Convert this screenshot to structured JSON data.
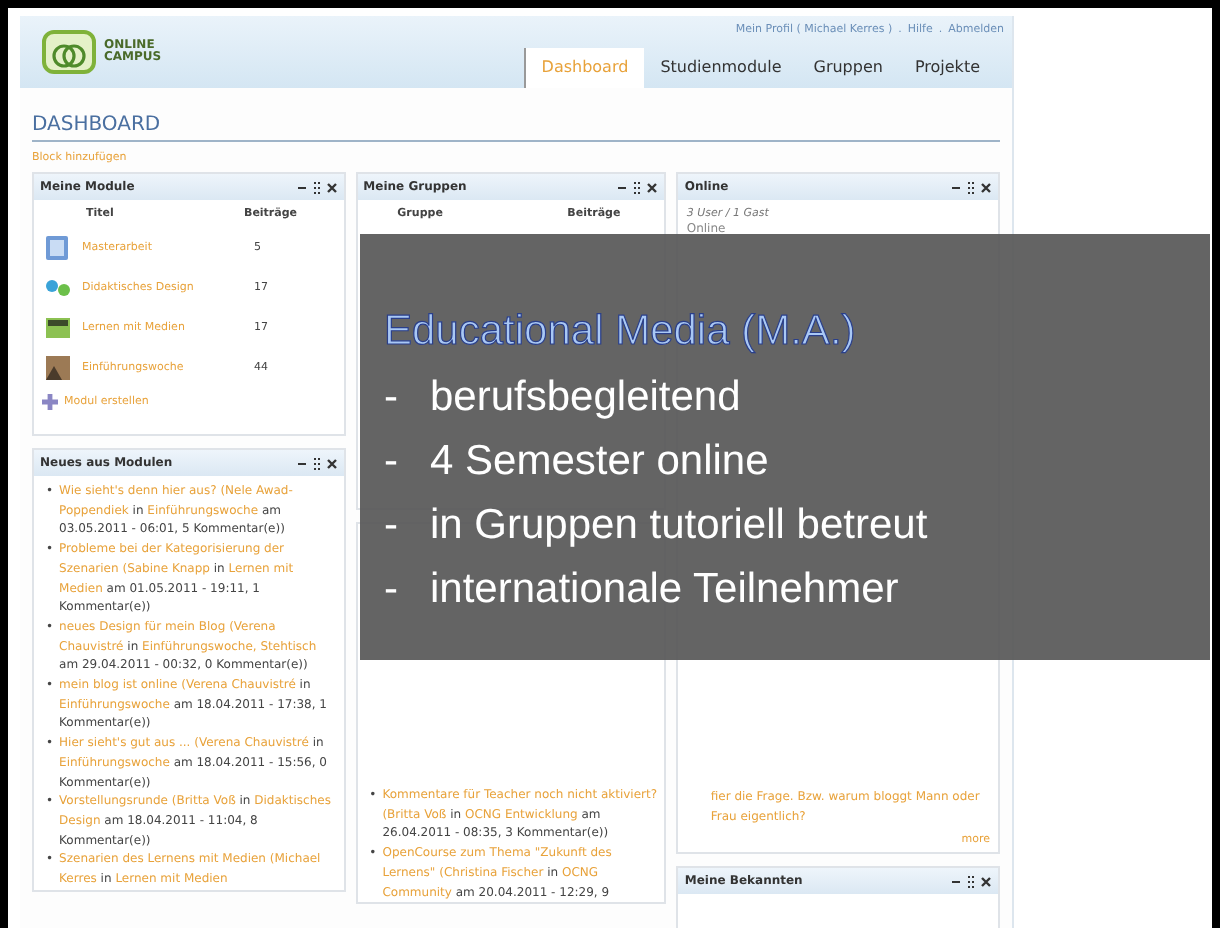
{
  "header": {
    "logo": [
      "ONLINE",
      "CAMPUS"
    ],
    "links": [
      "Mein Profil ( Michael Kerres )",
      "Hilfe",
      "Abmelden"
    ],
    "separator": "."
  },
  "tabs": [
    {
      "label": "Dashboard",
      "selected": true
    },
    {
      "label": "Studienmodule",
      "selected": false
    },
    {
      "label": "Gruppen",
      "selected": false
    },
    {
      "label": "Projekte",
      "selected": false
    }
  ],
  "page_title": "DASHBOARD",
  "add_block": "Block hinzufügen",
  "modules": {
    "title": "Meine Module",
    "columns": [
      "Titel",
      "Beiträge"
    ],
    "rows": [
      {
        "name": "Masterarbeit",
        "count": "5"
      },
      {
        "name": "Didaktisches Design",
        "count": "17"
      },
      {
        "name": "Lernen mit Medien",
        "count": "17"
      },
      {
        "name": "Einführungswoche",
        "count": "44"
      }
    ],
    "create": "Modul erstellen"
  },
  "module_news": {
    "title": "Neues aus Modulen",
    "items": [
      {
        "title": "Wie sieht's denn hier aus?",
        "author": "(Nele Awad-Poppendiek",
        "in": "in",
        "place": "Einführungswoche",
        "tail": "am 03.05.2011 - 06:01, 5 Kommentar(e))"
      },
      {
        "title": "Probleme bei der Kategorisierung der Szenarien",
        "author": "(Sabine Knapp",
        "in": "in",
        "place": "Lernen mit Medien",
        "tail": "am 01.05.2011 - 19:11, 1 Kommentar(e))"
      },
      {
        "title": "neues Design für mein Blog",
        "author": "(Verena Chauvistré",
        "in": "in",
        "place": "Einführungswoche, Stehtisch",
        "tail": "am 29.04.2011 - 00:32, 0 Kommentar(e))"
      },
      {
        "title": "mein blog ist online",
        "author": "(Verena Chauvistré",
        "in": "in",
        "place": "Einführungswoche",
        "tail": "am 18.04.2011 - 17:38, 1 Kommentar(e))"
      },
      {
        "title": "Hier sieht's gut aus ...",
        "author": "(Verena Chauvistré",
        "in": "in",
        "place": "Einführungswoche",
        "tail": "am 18.04.2011 - 15:56, 0 Kommentar(e))"
      },
      {
        "title": "Vorstellungsrunde",
        "author": "(Britta Voß",
        "in": "in",
        "place": "Didaktisches Design",
        "tail": "am 18.04.2011 - 11:04, 8 Kommentar(e))"
      },
      {
        "title": "Szenarien des Lernens mit Medien",
        "author": "(Michael Kerres",
        "in": "in",
        "place": "Lernen mit Medien"
      }
    ]
  },
  "bullet": "•",
  "groups": {
    "title": "Meine Gruppen",
    "columns": [
      "Gruppe",
      "Beiträge"
    ]
  },
  "group_news": {
    "items": [
      {
        "title": "Kommentare für Teacher noch nicht aktiviert?",
        "author": "(Britta Voß",
        "in": "in",
        "place": "OCNG Entwicklung",
        "tail": "am 26.04.2011 - 08:35, 3 Kommentar(e))"
      },
      {
        "title": "OpenCourse zum Thema \"Zukunft des Lernens\"",
        "author": "(Christina Fischer",
        "in": "in",
        "place": "OCNG Community",
        "tail": "am 20.04.2011 - 12:29, 9"
      }
    ]
  },
  "online": {
    "title": "Online",
    "summary": "3 User / 1 Gast",
    "label": "Online",
    "continued": "fier die Frage. Bzw. warum bloggt Mann oder Frau eigentlich?",
    "more": "more"
  },
  "contacts": {
    "title": "Meine Bekannten"
  },
  "overlay": {
    "title": "Educational Media (M.A.)",
    "marker": "-",
    "bullets": [
      "berufsbegleitend",
      "4 Semester online",
      "in Gruppen tutoriell betreut",
      "internationale Teilnehmer"
    ]
  }
}
